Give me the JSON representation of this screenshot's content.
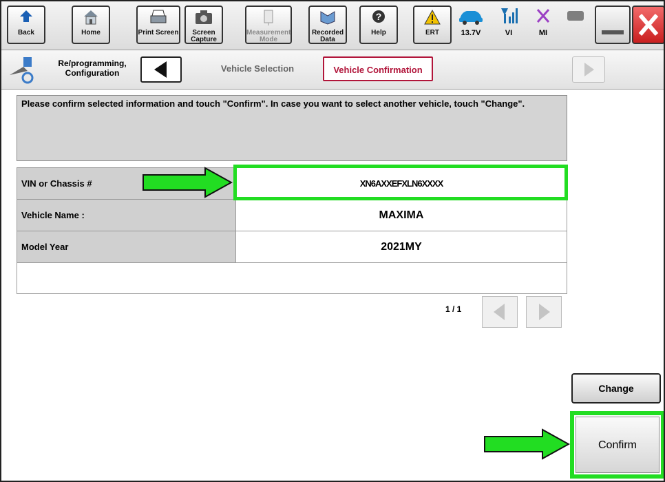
{
  "toolbar": {
    "buttons": [
      {
        "label": "Back",
        "icon": "back-arrow-icon"
      },
      {
        "label": "Home",
        "icon": "home-icon"
      },
      {
        "label": "Print Screen",
        "icon": "printer-icon"
      },
      {
        "label": "Screen Capture",
        "icon": "camera-icon"
      },
      {
        "label": "Measurement Mode",
        "icon": "measurement-icon"
      },
      {
        "label": "Recorded Data",
        "icon": "recorded-data-icon"
      },
      {
        "label": "Help",
        "icon": "help-icon"
      },
      {
        "label": "ERT",
        "icon": "warning-icon"
      }
    ],
    "status": {
      "voltage": "13.7V",
      "vi": "VI",
      "mi": "MI"
    }
  },
  "breadcrumb": {
    "title": "Re/programming, Configuration",
    "steps": [
      "Vehicle Selection",
      "Vehicle Confirmation"
    ]
  },
  "message": "Please confirm selected information and touch \"Confirm\". In case you want to select another vehicle, touch \"Change\".",
  "vehicle_info": [
    {
      "label": "VIN or Chassis #",
      "value": "XN6AXXEFXLN6XXXX"
    },
    {
      "label": "Vehicle Name :",
      "value": "MAXIMA"
    },
    {
      "label": "Model Year",
      "value": "2021MY"
    }
  ],
  "pager": {
    "text": "1 / 1"
  },
  "actions": {
    "change": "Change",
    "confirm": "Confirm"
  },
  "colors": {
    "highlight": "#22dd22",
    "active_step": "#b1153a",
    "close": "#d62b2b"
  }
}
